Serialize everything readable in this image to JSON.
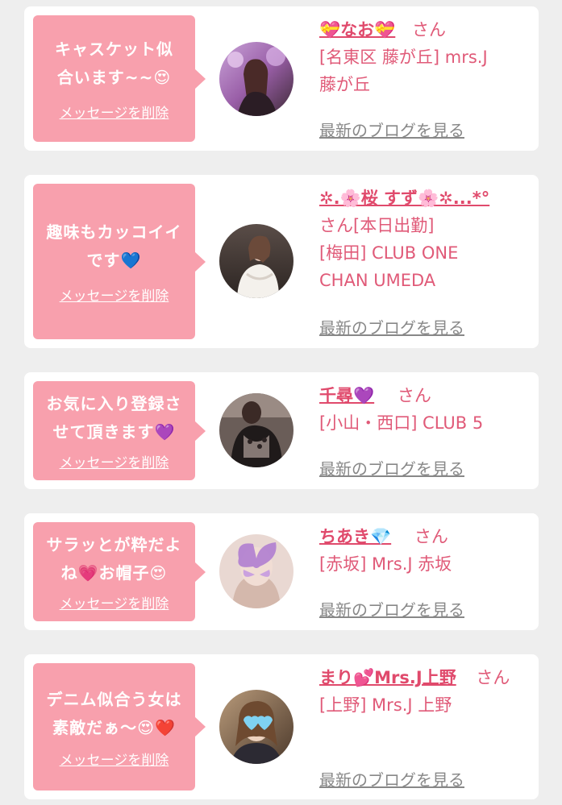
{
  "colors": {
    "bubble": "#f8a0ad",
    "card": "#ffffff",
    "name": "#e04a6c",
    "text": "#e05a78",
    "link": "#888888",
    "background": "#eeeeee"
  },
  "items": [
    {
      "message": "キャスケット似合います~~😍",
      "delete_label": "メッセージを削除",
      "name": "💝なお💝",
      "honorific": "さん",
      "shop_lines": [
        "[名東区 藤が丘] mrs.J",
        "藤が丘"
      ],
      "blog_label": "最新のブログを見る",
      "avatar_icon": "woman-photo-purple-icon"
    },
    {
      "message": "趣味もカッコイイです💙",
      "delete_label": "メッセージを削除",
      "name_lines": [
        "✲.🌸桜 すず🌸✲...*°",
        "さん[本日出勤]"
      ],
      "shop_lines": [
        "[梅田] CLUB ONE",
        "CHAN UMEDA"
      ],
      "blog_label": "最新のブログを見る",
      "avatar_icon": "woman-photo-white-dress-icon"
    },
    {
      "message": "お気に入り登録させて頂きます💜",
      "delete_label": "メッセージを削除",
      "name": "千尋💜",
      "honorific": "さん",
      "shop_lines": [
        "[小山・西口] CLUB 5"
      ],
      "blog_label": "最新のブログを見る",
      "avatar_icon": "woman-photo-black-lace-icon"
    },
    {
      "message": "サラッとが粋だよね💗お帽子😍",
      "delete_label": "メッセージを削除",
      "name": "ちあき💎",
      "honorific": "さん",
      "shop_lines": [
        "[赤坂] Mrs.J 赤坂"
      ],
      "blog_label": "最新のブログを見る",
      "avatar_icon": "woman-photo-butterfly-icon"
    },
    {
      "message": "デニム似合う女は素敵だぁ～😍❤️",
      "delete_label": "メッセージを削除",
      "name": "まり💕Mrs.J上野",
      "honorific": "さん",
      "shop_lines": [
        "[上野] Mrs.J 上野"
      ],
      "blog_label": "最新のブログを見る",
      "avatar_icon": "woman-photo-hearts-icon"
    }
  ]
}
